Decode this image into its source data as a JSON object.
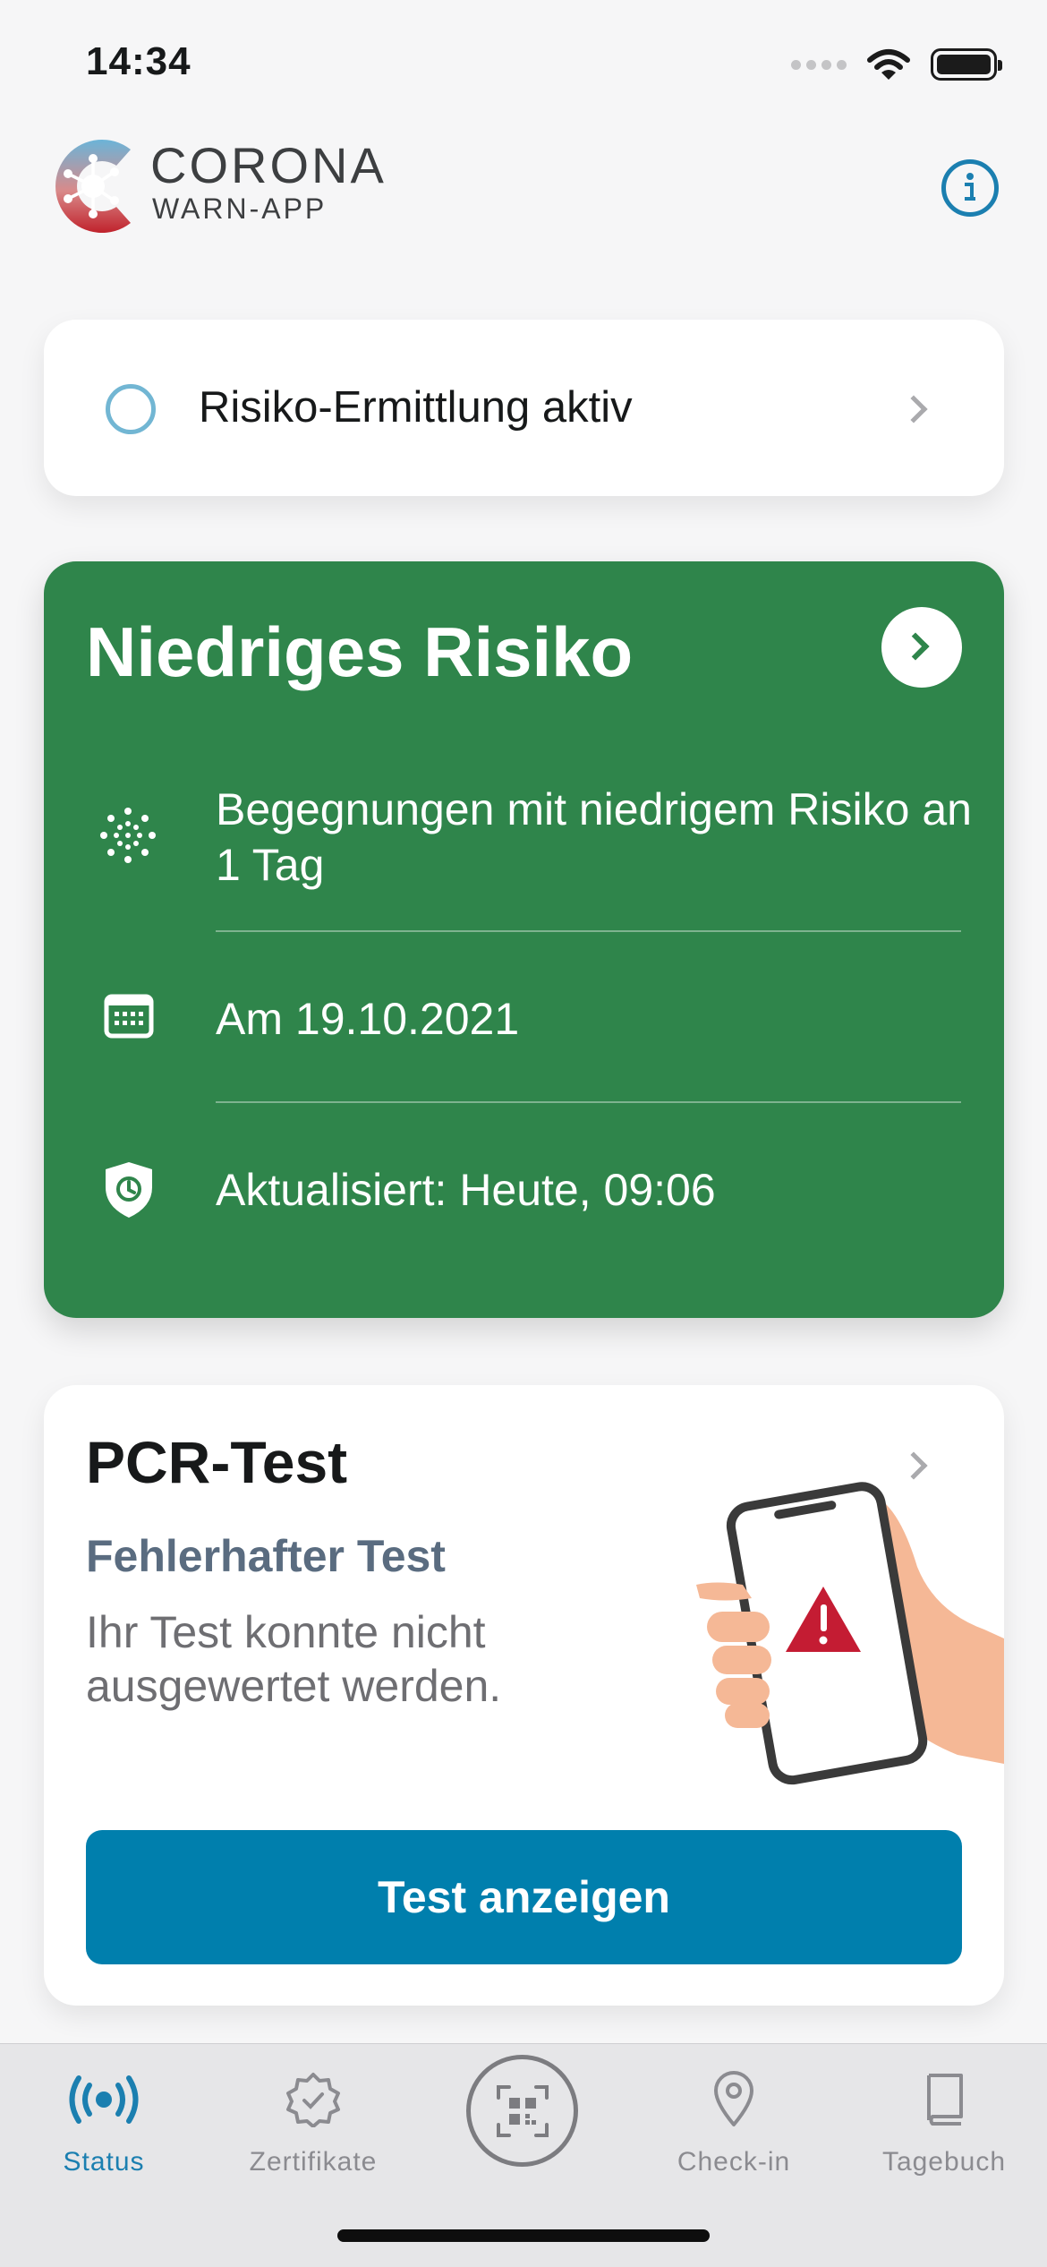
{
  "status_bar": {
    "time": "14:34"
  },
  "header": {
    "brand_title": "CORONA",
    "brand_subtitle": "WARN-APP"
  },
  "detection": {
    "label": "Risiko-Ermittlung aktiv"
  },
  "risk": {
    "title": "Niedriges Risiko",
    "encounters": "Begegnungen mit niedrigem Risiko an 1 Tag",
    "date": "Am 19.10.2021",
    "updated": "Aktualisiert: Heute, 09:06",
    "color": "#2f854b"
  },
  "pcr": {
    "title": "PCR-Test",
    "status": "Fehlerhafter Test",
    "description": "Ihr Test konnte nicht ausgewertet werden.",
    "button_label": "Test anzeigen",
    "button_color": "#007fad"
  },
  "tabs": [
    {
      "label": "Status",
      "icon": "broadcast-icon",
      "active": true
    },
    {
      "label": "Zertifikate",
      "icon": "certificate-icon",
      "active": false
    },
    {
      "label": "",
      "icon": "qr-scan-icon",
      "active": false
    },
    {
      "label": "Check-in",
      "icon": "location-pin-icon",
      "active": false
    },
    {
      "label": "Tagebuch",
      "icon": "diary-icon",
      "active": false
    }
  ],
  "accent_color": "#1b7fb0"
}
